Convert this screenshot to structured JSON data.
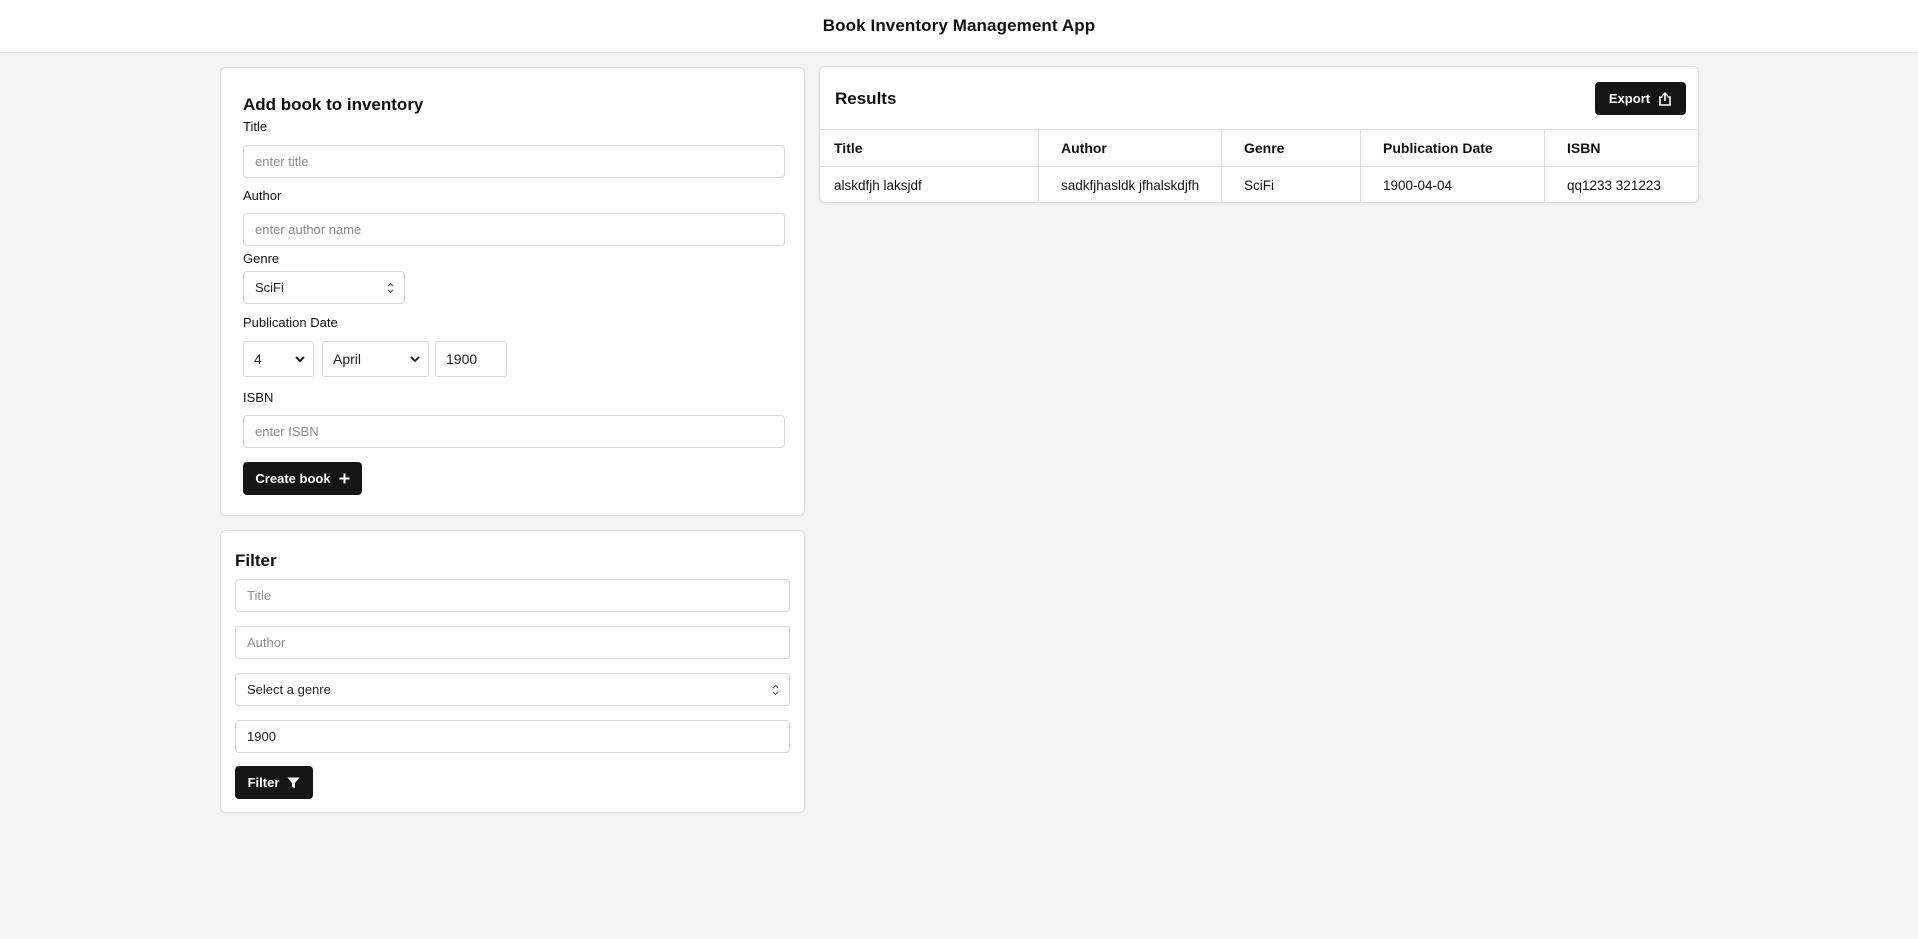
{
  "app": {
    "title": "Book Inventory Management App"
  },
  "add_book": {
    "title": "Add book to inventory",
    "title_label": "Title",
    "title_placeholder": "enter title",
    "author_label": "Author",
    "author_placeholder": "enter author name",
    "genre_label": "Genre",
    "genre_value": "SciFi",
    "pub_date_label": "Publication Date",
    "day_value": "4",
    "month_value": "April",
    "year_value": "1900",
    "isbn_label": "ISBN",
    "isbn_placeholder": "enter ISBN",
    "create_button": "Create book"
  },
  "filter": {
    "title": "Filter",
    "title_placeholder": "Title",
    "author_placeholder": "Author",
    "genre_placeholder": "Select a genre",
    "year_value": "1900",
    "filter_button": "Filter"
  },
  "results": {
    "title": "Results",
    "export_button": "Export",
    "columns": [
      "Title",
      "Author",
      "Genre",
      "Publication Date",
      "ISBN"
    ],
    "rows": [
      [
        "alskdfjh laksjdf",
        "sadkfjhasldk jfhalskdjfh",
        "SciFi",
        "1900-04-04",
        "qq1233 321223"
      ]
    ]
  },
  "colors": {
    "button_bg": "#151515",
    "page_bg": "#f4f4f4",
    "card_border": "#dedede"
  }
}
